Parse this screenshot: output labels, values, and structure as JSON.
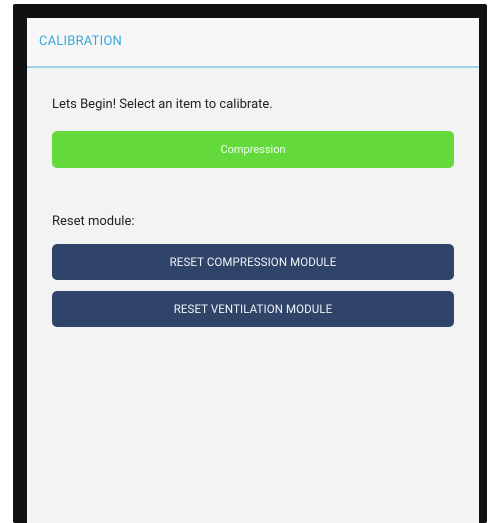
{
  "appbar": {
    "title": "CALIBRATION"
  },
  "content": {
    "intro_text": "Lets Begin! Select an item to calibrate.",
    "compression_button": "Compression",
    "reset_label": "Reset module:",
    "reset_compression_button": "RESET COMPRESSION MODULE",
    "reset_ventilation_button": "RESET VENTILATION MODULE"
  },
  "colors": {
    "accent": "#39a7da",
    "green_button": "#63d93b",
    "navy_button": "#2f4468"
  }
}
